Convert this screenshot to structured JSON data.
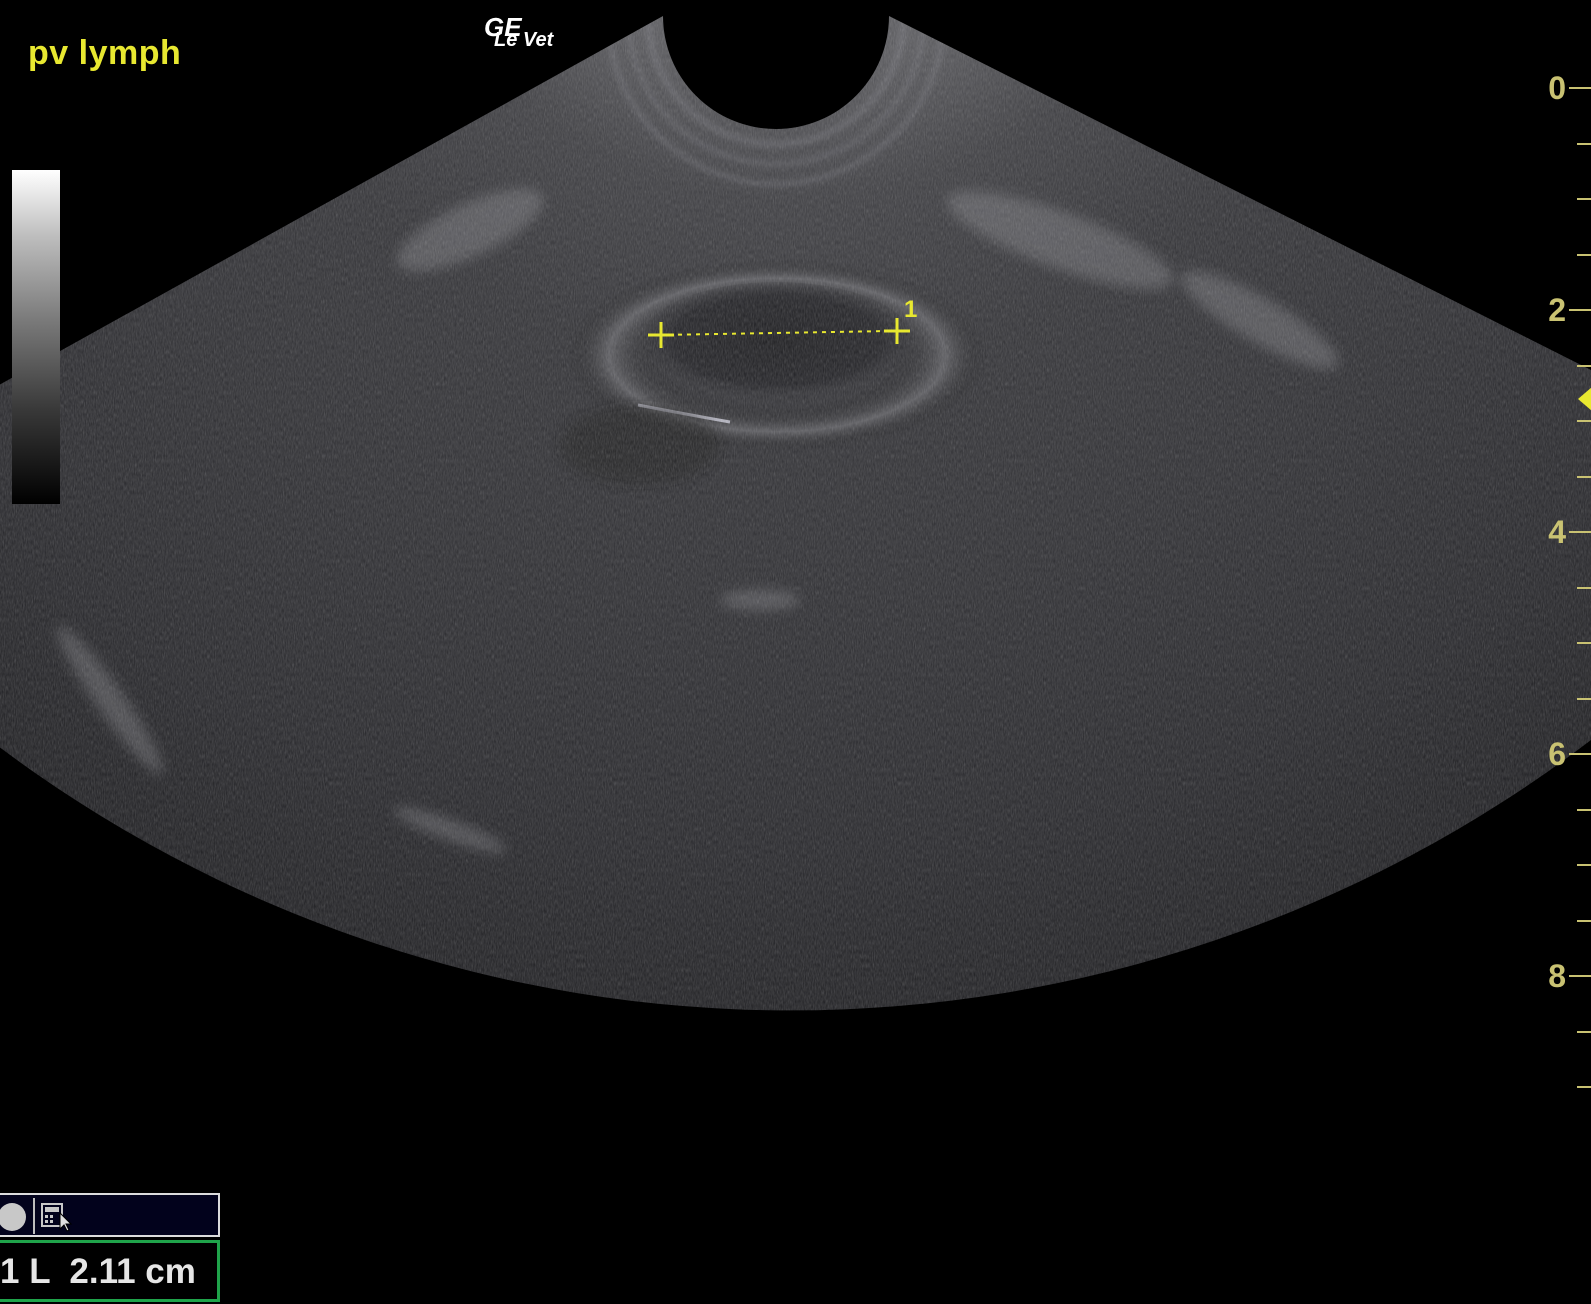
{
  "header": {
    "image_label": "pv lymph",
    "logo_brand": "GE",
    "logo_model": "Le Vet"
  },
  "depth_scale": {
    "unit": "cm",
    "labels": [
      "0",
      "2",
      "4",
      "6",
      "8"
    ],
    "max_depth_cm": 9,
    "focus_depth_cm": 2.8
  },
  "caliper": {
    "index_label": "1",
    "length_cm": 2.11
  },
  "measurement": {
    "index": "1",
    "type": "L",
    "value": "2.11",
    "unit": "cm"
  },
  "toolbar": {
    "icons": [
      "record-circle-icon",
      "calculator-cursor-icon"
    ]
  },
  "colors": {
    "annotation_yellow": "#e8e830",
    "scale_yellow": "#c9c272",
    "measurement_border_green": "#1fa34a",
    "background": "#000000"
  }
}
